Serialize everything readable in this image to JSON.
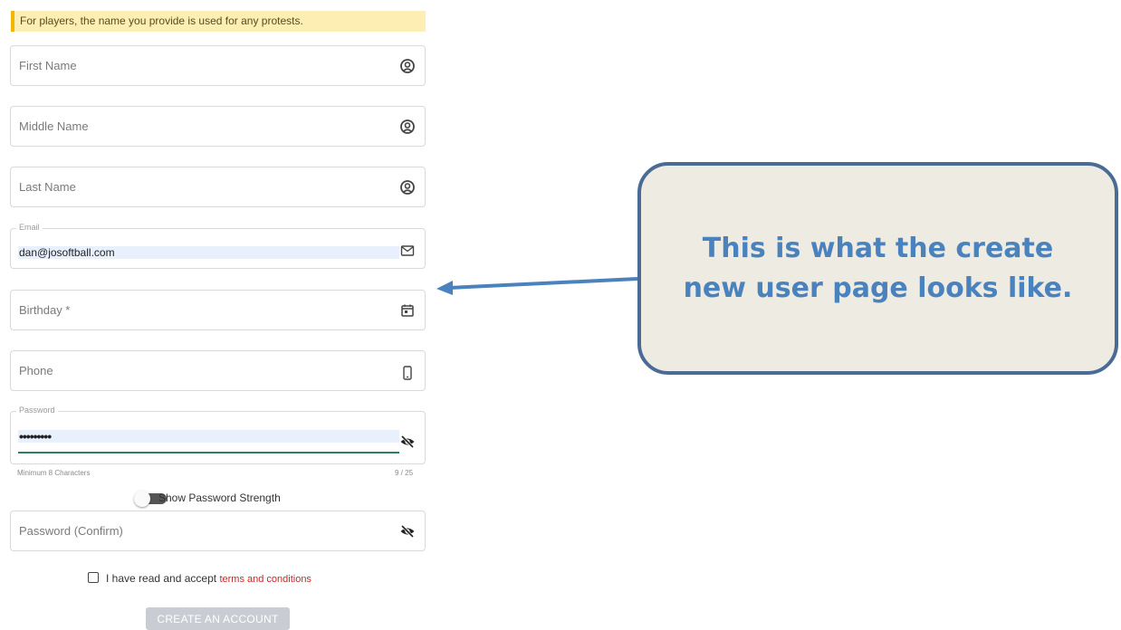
{
  "notice": "For players, the name you provide is used for any protests.",
  "fields": {
    "first_name": {
      "placeholder": "First Name",
      "icon": "person-icon"
    },
    "middle_name": {
      "placeholder": "Middle Name",
      "icon": "person-icon"
    },
    "last_name": {
      "placeholder": "Last Name",
      "icon": "person-icon"
    },
    "email": {
      "label": "Email",
      "value": "dan@josoftball.com",
      "icon": "envelope-icon"
    },
    "birthday": {
      "placeholder": "Birthday *",
      "icon": "calendar-icon"
    },
    "phone": {
      "placeholder": "Phone",
      "icon": "phone-icon"
    },
    "password": {
      "label": "Password",
      "value": "•••••••••",
      "icon": "eye-off-icon",
      "hint": "Minimum 8 Characters",
      "counter": "9 / 25"
    },
    "password_confirm": {
      "placeholder": "Password (Confirm)",
      "icon": "eye-off-icon"
    }
  },
  "strength_toggle": {
    "label": "Show Password Strength",
    "on": false
  },
  "terms": {
    "text": "I have read and accept",
    "link": "terms and conditions",
    "checked": false
  },
  "create_button": "CREATE AN ACCOUNT",
  "callout": {
    "text": "This is what the create new user page looks like."
  },
  "colors": {
    "accent_green": "#2e7d5e",
    "link_red": "#c62828",
    "callout_blue": "#4a82bd",
    "callout_border": "#4a6b95"
  }
}
